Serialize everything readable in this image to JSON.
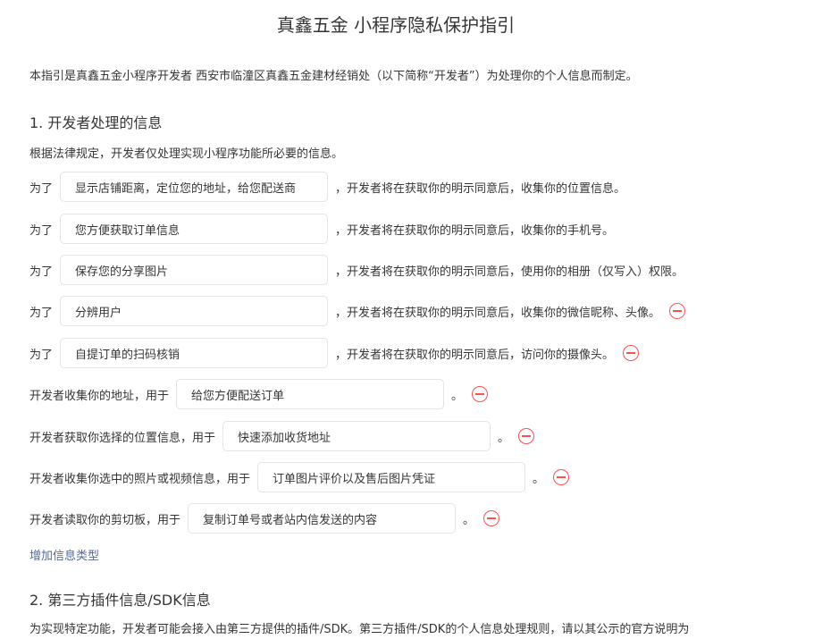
{
  "title": "真鑫五金 小程序隐私保护指引",
  "intro": "本指引是真鑫五金小程序开发者 西安市临潼区真鑫五金建材经销处（以下简称“开发者”）为处理你的个人信息而制定。",
  "section1": {
    "title": "1.  开发者处理的信息",
    "desc": "根据法律规定，开发者仅处理实现小程序功能所必要的信息。"
  },
  "rows": [
    {
      "prefix": "为了",
      "value": "显示店铺距离，定位您的地址，给您配送商",
      "suffix": "，开发者将在获取你的明示同意后，收集你的位置信息。"
    },
    {
      "prefix": "为了",
      "value": "您方便获取订单信息",
      "suffix": "，开发者将在获取你的明示同意后，收集你的手机号。"
    },
    {
      "prefix": "为了",
      "value": "保存您的分享图片",
      "suffix": "，开发者将在获取你的明示同意后，使用你的相册（仅写入）权限。"
    },
    {
      "prefix": "为了",
      "value": "分辨用户",
      "suffix": "，开发者将在获取你的明示同意后，收集你的微信昵称、头像。"
    },
    {
      "prefix": "为了",
      "value": "自提订单的扫码核销",
      "suffix": "，开发者将在获取你的明示同意后，访问你的摄像头。"
    },
    {
      "prefix": "开发者收集你的地址，用于",
      "value": "给您方便配送订单",
      "suffix": "。"
    },
    {
      "prefix": "开发者获取你选择的位置信息，用于",
      "value": "快速添加收货地址",
      "suffix": "。"
    },
    {
      "prefix": "开发者收集你选中的照片或视频信息，用于",
      "value": "订单图片评价以及售后图片凭证",
      "suffix": "。"
    },
    {
      "prefix": "开发者读取你的剪切板，用于",
      "value": "复制订单号或者站内信发送的内容",
      "suffix": "。"
    }
  ],
  "add_link": "增加信息类型",
  "section2": {
    "title": "2.  第三方插件信息/SDK信息",
    "desc": "为实现特定功能，开发者可能会接入由第三方提供的插件/SDK。第三方插件/SDK的个人信息处理规则，请以其公示的官方说明为"
  },
  "colors": {
    "remove": "#fa5151",
    "link": "#576b95"
  }
}
